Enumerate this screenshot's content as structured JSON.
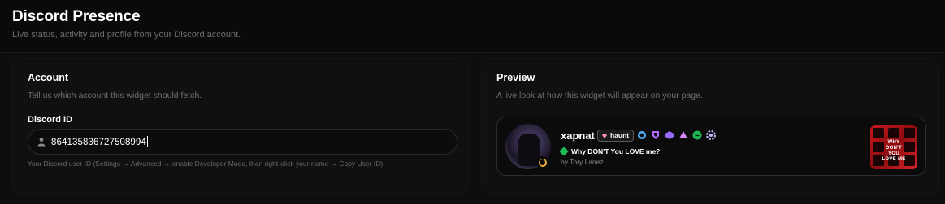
{
  "header": {
    "title": "Discord Presence",
    "subtitle": "Live status, activity and profile from your Discord account."
  },
  "account": {
    "title": "Account",
    "description": "Tell us which account this widget should fetch.",
    "field_label": "Discord ID",
    "field_value": "864135836727508994",
    "field_icon": "user-icon",
    "hint": "Your Discord user ID (Settings → Advanced → enable Developer Mode, then right-click your name → Copy User ID)."
  },
  "preview": {
    "title": "Preview",
    "description": "A live look at how this widget will appear on your page.",
    "profile": {
      "username": "xapnat",
      "tag": "haunt",
      "status": "idle",
      "badges": [
        "hypesquad-icon",
        "nitro-icon",
        "quest-icon",
        "triangle-icon",
        "spotify-icon",
        "boost-icon"
      ]
    },
    "activity": {
      "track": "Why DON'T You LOVE me?",
      "artist": "by Tory Lanez",
      "album_art_text": "WHY DON'T YOU LOVE ME"
    }
  },
  "colors": {
    "background": "#0a0a0a",
    "card": "#101010",
    "muted_text": "#707070",
    "spotify_green": "#1db954",
    "idle_yellow": "#f0b232"
  }
}
